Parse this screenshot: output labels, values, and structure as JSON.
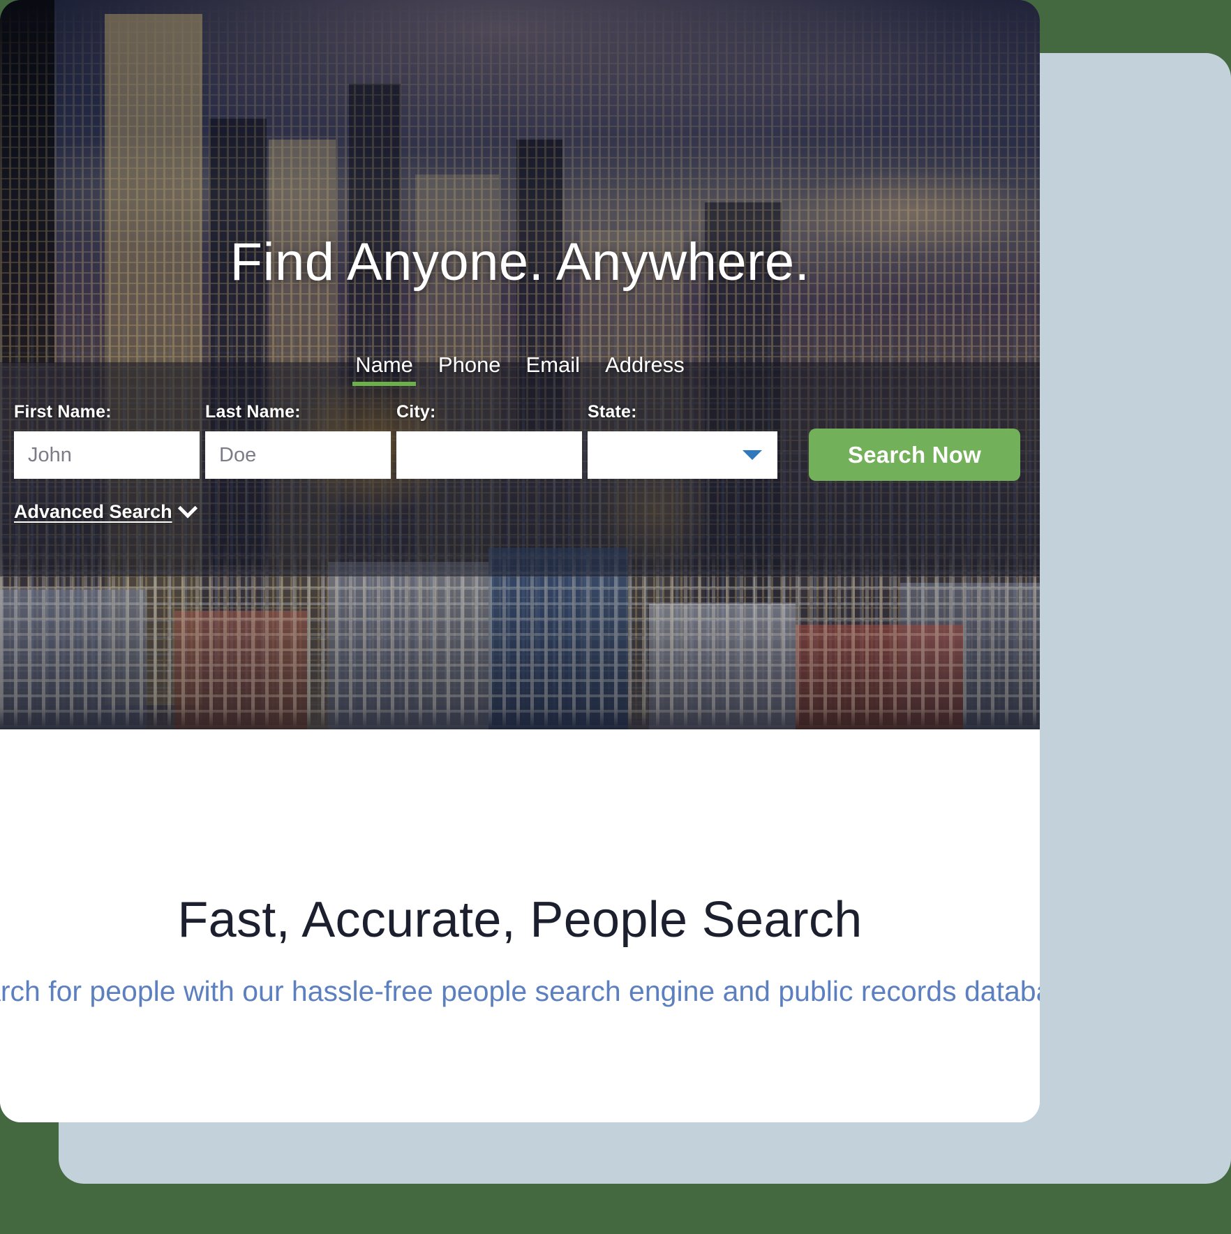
{
  "theme": {
    "outer_background": "#44683F",
    "panel_background": "#C3D1DA",
    "accent_green": "#72B059",
    "tab_underline_green": "#6CB04A",
    "dropdown_arrow_blue": "#2F78BE",
    "subtitle_blue": "#5C7FC0"
  },
  "hero": {
    "headline": "Find Anyone. Anywhere.",
    "tabs": [
      {
        "label": "Name",
        "active": true
      },
      {
        "label": "Phone",
        "active": false
      },
      {
        "label": "Email",
        "active": false
      },
      {
        "label": "Address",
        "active": false
      }
    ],
    "form": {
      "first_name": {
        "label": "First Name:",
        "placeholder": "John",
        "value": ""
      },
      "last_name": {
        "label": "Last Name:",
        "placeholder": "Doe",
        "value": ""
      },
      "city": {
        "label": "City:",
        "placeholder": "",
        "value": ""
      },
      "state": {
        "label": "State:",
        "selected": "",
        "options": [
          ""
        ]
      },
      "search_button": "Search Now",
      "advanced_search": "Advanced Search",
      "advanced_search_icon": "chevron-down-icon"
    }
  },
  "bottom": {
    "title": "Fast, Accurate, People Search",
    "subtitle": "Search for people with our hassle-free people search engine and public records database."
  }
}
